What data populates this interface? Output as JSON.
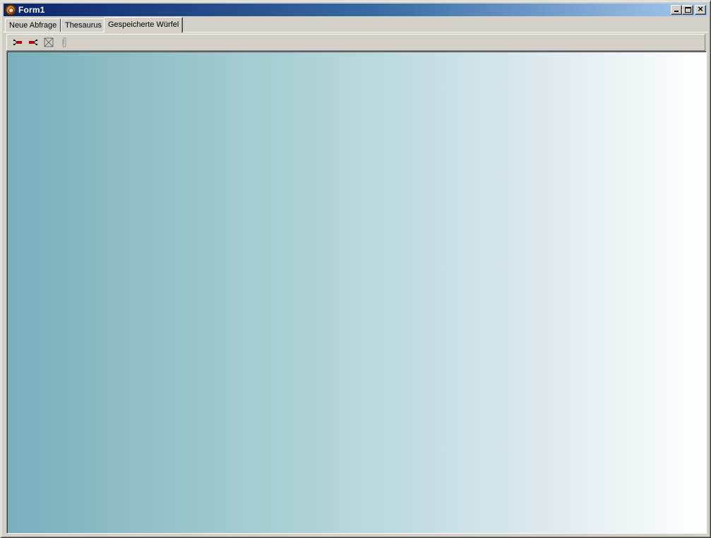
{
  "window": {
    "title": "Form1",
    "buttons": [
      "minimize",
      "maximize",
      "close"
    ]
  },
  "tabs": [
    {
      "label": "Neue Abfrage",
      "active": false
    },
    {
      "label": "Thesaurus",
      "active": false
    },
    {
      "label": "Gespeicherte Würfel",
      "active": true
    }
  ],
  "toolbar": {
    "items": [
      {
        "icon": "expand-tree-icon",
        "enabled": true
      },
      {
        "icon": "collapse-tree-icon",
        "enabled": true
      },
      {
        "icon": "delete-box-icon",
        "enabled": true
      },
      {
        "icon": "paperclip-icon",
        "enabled": false
      }
    ]
  },
  "content": {
    "gradient": [
      "#78b0ba",
      "#ffffff"
    ]
  },
  "colors": {
    "titlebar_start": "#0a246a",
    "titlebar_end": "#a6caf0",
    "face": "#d4d0c8"
  }
}
